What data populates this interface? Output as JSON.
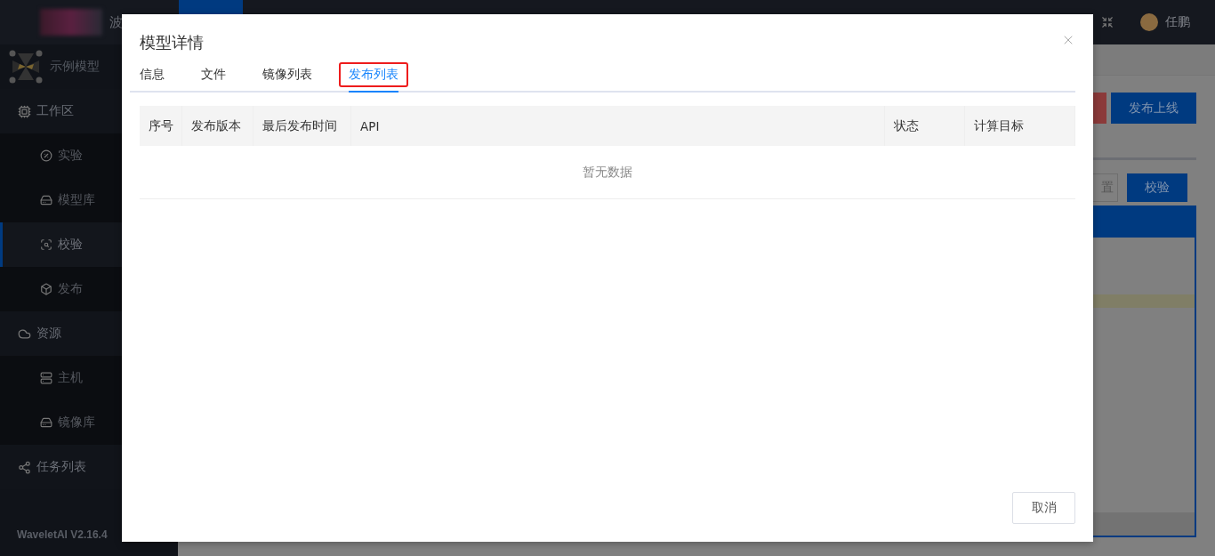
{
  "top_bar": {
    "brand": "波",
    "user": {
      "name": "任鹏"
    }
  },
  "sidebar": {
    "model": "示例模型",
    "items": [
      {
        "label": "工作区",
        "children": [
          {
            "label": "实验",
            "selected": false
          },
          {
            "label": "模型库",
            "selected": false
          },
          {
            "label": "校验",
            "selected": true
          },
          {
            "label": "发布",
            "selected": false
          }
        ]
      },
      {
        "label": "资源",
        "children": [
          {
            "label": "主机",
            "selected": false
          },
          {
            "label": "镜像库",
            "selected": false
          }
        ]
      },
      {
        "label": "任务列表"
      }
    ],
    "version": "WaveletAI V2.16.4"
  },
  "main": {
    "publish_button": "发布上线",
    "partial_button": "置",
    "check_button": "校验"
  },
  "modal": {
    "title": "模型详情",
    "tabs": [
      {
        "label": "信息",
        "selected": false,
        "highlighted": false
      },
      {
        "label": "文件",
        "selected": false,
        "highlighted": false
      },
      {
        "label": "镜像列表",
        "selected": false,
        "highlighted": false
      },
      {
        "label": "发布列表",
        "selected": true,
        "highlighted": true
      }
    ],
    "table": {
      "columns": [
        "序号",
        "发布版本",
        "最后发布时间",
        "API",
        "状态",
        "计算目标"
      ],
      "empty_text": "暂无数据"
    },
    "buttons": [
      "取消"
    ]
  }
}
